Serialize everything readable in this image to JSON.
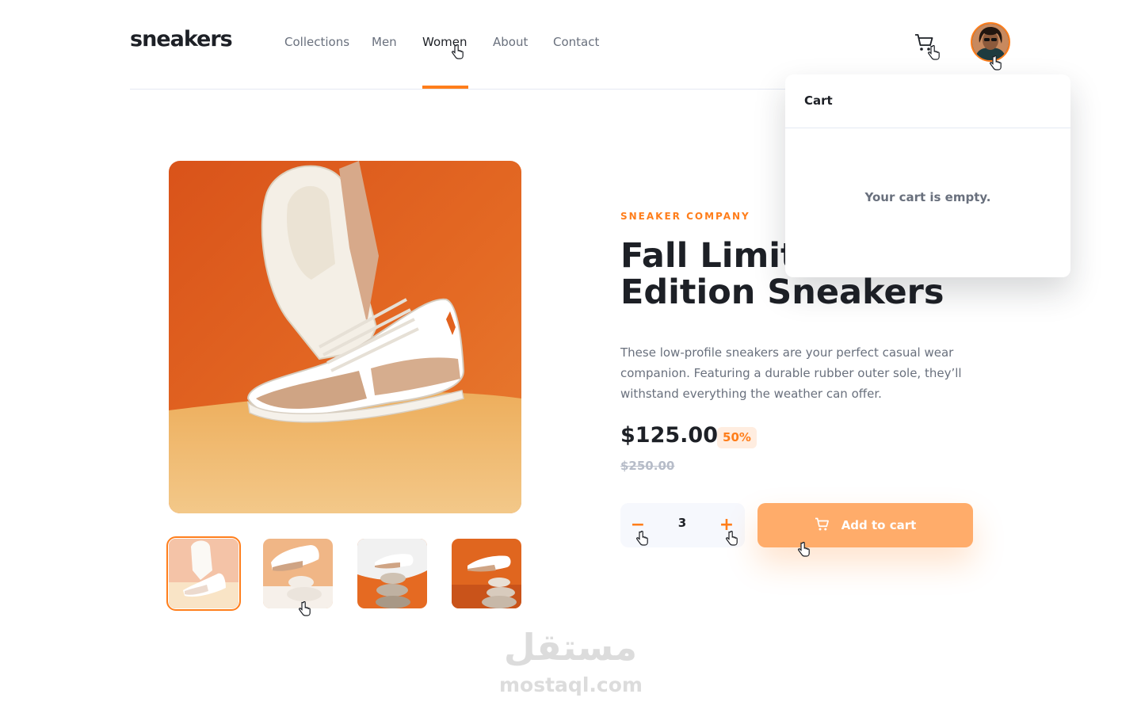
{
  "brand": "sneakers",
  "nav": [
    "Collections",
    "Men",
    "Women",
    "About",
    "Contact"
  ],
  "nav_active": "Women",
  "cart": {
    "title": "Cart",
    "empty_text": "Your cart is empty."
  },
  "product": {
    "company": "SNEAKER COMPANY",
    "title": "Fall Limited Edition Sneakers",
    "description": "These low-profile sneakers are your perfect casual wear companion. Featuring a durable rubber outer sole, they’ll withstand everything the weather can offer.",
    "price": "$125.00",
    "discount": "50%",
    "old_price": "$250.00",
    "quantity": "3",
    "minus_symbol": "−",
    "plus_symbol": "+",
    "add_to_cart_label": "Add to cart"
  },
  "watermark": {
    "arabic": "مستقل",
    "latin": "mostaql.com"
  },
  "colors": {
    "accent": "#ff7e1b",
    "dark": "#1d2026",
    "muted": "#69707d",
    "pale_orange": "#ffede0",
    "button": "#ffac6a"
  },
  "icons": [
    "cart-icon",
    "avatar",
    "minus-icon",
    "plus-icon",
    "hand-cursor-icon"
  ]
}
